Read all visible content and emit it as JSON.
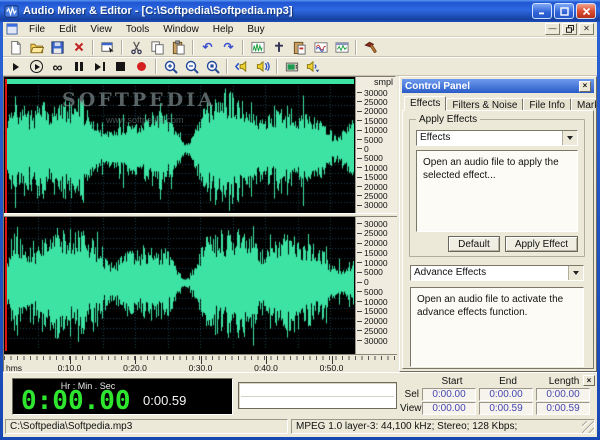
{
  "window": {
    "title": "Audio Mixer & Editor - [C:\\Softpedia\\Softpedia.mp3]",
    "minimize": "_",
    "maximize": "",
    "close": "×"
  },
  "menu": {
    "items": [
      "File",
      "Edit",
      "View",
      "Tools",
      "Window",
      "Help",
      "Buy"
    ]
  },
  "toolbar_file_icons": [
    "new",
    "open",
    "save",
    "delete",
    "properties",
    "cut",
    "copy",
    "paste",
    "undo",
    "redo",
    "waveform-view",
    "mix-paste",
    "paste-special",
    "mixer",
    "mix-window",
    "tools"
  ],
  "toolbar_play_icons": [
    "play",
    "play-all",
    "loop",
    "pause",
    "play-step",
    "stop",
    "record",
    "zoom-in",
    "zoom-out",
    "zoom-selection",
    "play-from-start",
    "play-selection",
    "display",
    "volume"
  ],
  "editor": {
    "scale_unit": "smpl",
    "scale_ticks": [
      "30000",
      "25000",
      "20000",
      "15000",
      "10000",
      "5000",
      "0",
      "5000",
      "10000",
      "15000",
      "20000",
      "25000",
      "30000"
    ],
    "ruler_unit": "hms",
    "ruler_labels": [
      "0:10.0",
      "0:20.0",
      "0:30.0",
      "0:40.0",
      "0:50.0"
    ],
    "watermark_title": "SOFTPEDIA",
    "watermark_sub": "www.softpedia.com",
    "wave_color": "#3ce3a2",
    "wave_bg": "#000000",
    "grid_color": "#1d4550"
  },
  "control_panel": {
    "title": "Control Panel",
    "close": "×",
    "tabs": [
      "Effects",
      "Filters & Noise",
      "File Info",
      "Markers"
    ],
    "group1_label": "Apply Effects",
    "combo1_value": "Effects",
    "info1": "Open an audio file to apply the selected effect...",
    "default_button": "Default",
    "apply_button": "Apply Effect",
    "combo2_value": "Advance Effects",
    "info2": "Open an audio file to activate the advance effects function."
  },
  "transport": {
    "time_units": "Hr  :  Min  .  Sec",
    "time_main": "0:00.00",
    "time_sub": "0:00.59"
  },
  "selection_panel": {
    "close": "×",
    "headers": [
      "Start",
      "End",
      "Length"
    ],
    "rows": [
      {
        "label": "Sel",
        "values": [
          "0:00.00",
          "0:00.00",
          "0:00.00"
        ]
      },
      {
        "label": "View",
        "values": [
          "0:00.00",
          "0:00.59",
          "0:00.59"
        ]
      }
    ]
  },
  "status": {
    "left": "C:\\Softpedia\\Softpedia.mp3",
    "right": "MPEG 1.0 layer-3: 44,100 kHz; Stereo; 128 Kbps;"
  }
}
